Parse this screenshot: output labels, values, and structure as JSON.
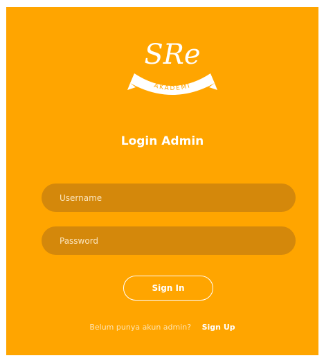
{
  "brand": {
    "logo_text": "SRe",
    "logo_ribbon": "AKADEMI"
  },
  "login": {
    "title": "Login Admin",
    "username_placeholder": "Username",
    "password_placeholder": "Password",
    "signin_label": "Sign In",
    "footer_prompt": "Belum punya akun admin?",
    "signup_label": "Sign Up"
  },
  "colors": {
    "panel": "#FFA500",
    "field": "#D4880B",
    "text": "#FFFFFF"
  }
}
